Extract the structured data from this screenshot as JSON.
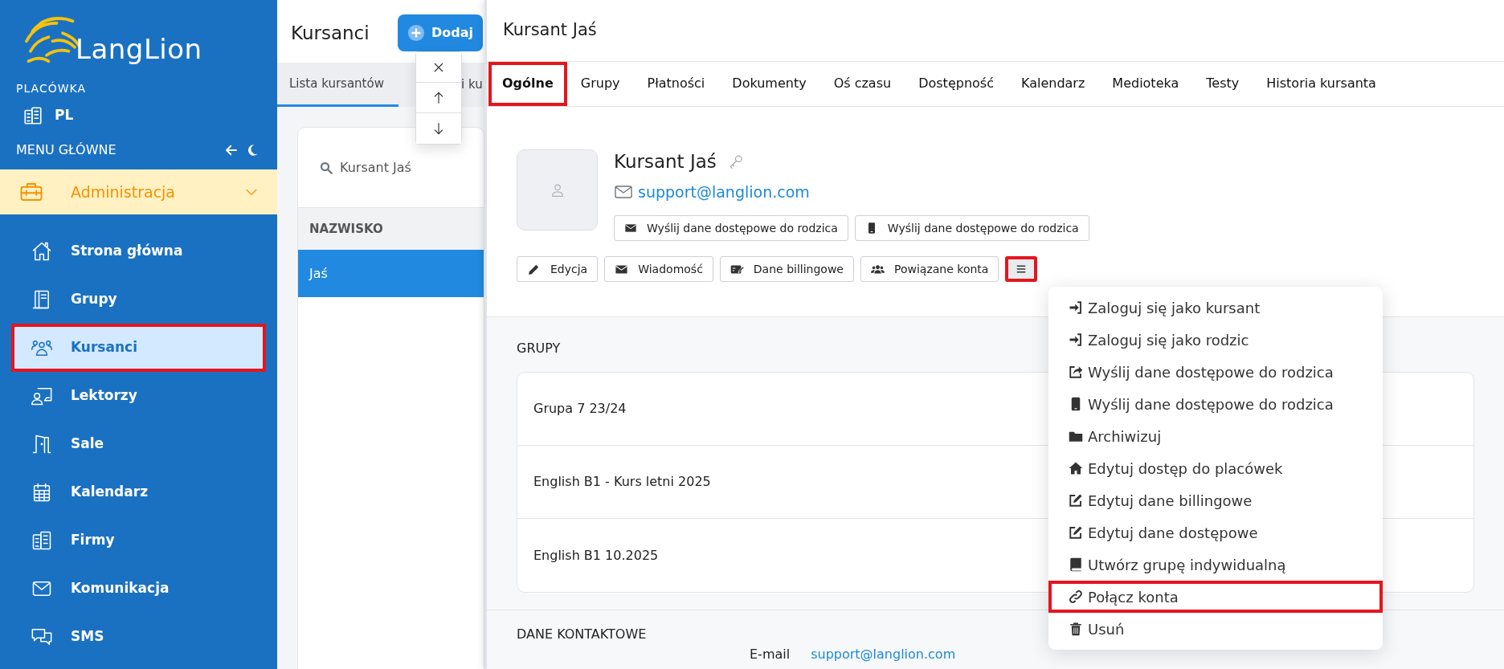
{
  "sidebar": {
    "logo": "LangLion",
    "branch_heading": "PLACÓWKA",
    "branch": "PL",
    "menu_heading": "MENU GŁÓWNE",
    "section": {
      "label": "Administracja",
      "expanded": true
    },
    "items": [
      {
        "label": "Strona główna",
        "selected": false,
        "highlighted": false
      },
      {
        "label": "Grupy",
        "selected": false,
        "highlighted": false
      },
      {
        "label": "Kursanci",
        "selected": true,
        "highlighted": true
      },
      {
        "label": "Lektorzy",
        "selected": false,
        "highlighted": false
      },
      {
        "label": "Sale",
        "selected": false,
        "highlighted": false
      },
      {
        "label": "Kalendarz",
        "selected": false,
        "highlighted": false
      },
      {
        "label": "Firmy",
        "selected": false,
        "highlighted": false
      },
      {
        "label": "Komunikacja",
        "selected": false,
        "highlighted": false
      },
      {
        "label": "SMS",
        "selected": false,
        "highlighted": false
      }
    ]
  },
  "students_page": {
    "title": "Kursanci",
    "add_button": "Dodaj",
    "tabs": [
      {
        "label": "Lista kursantów",
        "selected": true
      },
      {
        "label": "i ku",
        "selected": false
      }
    ],
    "search": {
      "value": "Kursant Jaś"
    },
    "column": "NAZWISKO",
    "rows": [
      {
        "surname": "Jaś",
        "selected": true
      }
    ]
  },
  "drawer": {
    "title": "Kursant Jaś",
    "tabs": [
      {
        "label": "Ogólne",
        "selected": true,
        "highlighted": true
      },
      {
        "label": "Grupy",
        "selected": false,
        "highlighted": false
      },
      {
        "label": "Płatności",
        "selected": false,
        "highlighted": false
      },
      {
        "label": "Dokumenty",
        "selected": false,
        "highlighted": false
      },
      {
        "label": "Oś czasu",
        "selected": false,
        "highlighted": false
      },
      {
        "label": "Dostępność",
        "selected": false,
        "highlighted": false
      },
      {
        "label": "Kalendarz",
        "selected": false,
        "highlighted": false
      },
      {
        "label": "Medioteka",
        "selected": false,
        "highlighted": false
      },
      {
        "label": "Testy",
        "selected": false,
        "highlighted": false
      },
      {
        "label": "Historia kursanta",
        "selected": false,
        "highlighted": false
      }
    ],
    "profile": {
      "name": "Kursant Jaś",
      "email": "support@langlion.com",
      "send_buttons": [
        "Wyślij dane dostępowe do rodzica",
        "Wyślij dane dostępowe do rodzica"
      ],
      "actions": [
        "Edycja",
        "Wiadomość",
        "Dane billingowe",
        "Powiązane konta"
      ],
      "more_menu": {
        "expanded": true,
        "highlighted": true
      }
    },
    "groups_heading": "GRUPY",
    "groups": [
      "Grupa 7 23/24",
      "English B1 - Kurs letni 2025",
      "English B1 10.2025"
    ],
    "contact_heading": "DANE KONTAKTOWE",
    "contact": [
      {
        "label": "E-mail",
        "value": "support@langlion.com"
      }
    ]
  },
  "menu": {
    "items": [
      {
        "label": "Zaloguj się jako kursant",
        "highlighted": false
      },
      {
        "label": "Zaloguj się jako rodzic",
        "highlighted": false
      },
      {
        "label": "Wyślij dane dostępowe do rodzica",
        "highlighted": false
      },
      {
        "label": "Wyślij dane dostępowe do rodzica",
        "highlighted": false
      },
      {
        "label": "Archiwizuj",
        "highlighted": false
      },
      {
        "label": "Edytuj dostęp do placówek",
        "highlighted": false
      },
      {
        "label": "Edytuj dane billingowe",
        "highlighted": false
      },
      {
        "label": "Edytuj dane dostępowe",
        "highlighted": false
      },
      {
        "label": "Utwórz grupę indywidualną",
        "highlighted": false
      },
      {
        "label": "Połącz konta",
        "highlighted": true
      },
      {
        "label": "Usuń",
        "highlighted": false
      }
    ]
  }
}
